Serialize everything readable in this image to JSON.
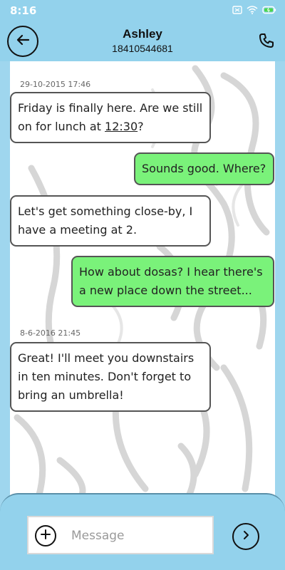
{
  "status_bar": {
    "time": "8:16"
  },
  "header": {
    "name": "Ashley",
    "phone": "18410544681"
  },
  "messages": [
    {
      "timestamp": "29-10-2015 17:46"
    },
    {
      "text_before": "Friday is finally here. Are we still on for lunch at ",
      "link": "12:30",
      "text_after": "?"
    },
    {
      "text": "Sounds good. Where?"
    },
    {
      "text": "Let's get something close-by, I have a meeting at 2."
    },
    {
      "text": "How about dosas? I hear there's a new place down the street..."
    },
    {
      "timestamp": "8-6-2016 21:45"
    },
    {
      "text": "Great! I'll meet you downstairs in ten minutes. Don't forget to bring an umbrella!"
    }
  ],
  "composer": {
    "placeholder": "Message",
    "value": ""
  },
  "icons": {
    "back": "arrow-left-icon",
    "call": "phone-icon",
    "plus": "plus-icon",
    "send": "chevron-right-icon",
    "status": [
      "sim-icon",
      "wifi-icon",
      "battery-icon"
    ]
  },
  "colors": {
    "header": "#93d2ec",
    "outgoing_bubble": "#7af27a",
    "incoming_bubble": "#ffffff"
  }
}
